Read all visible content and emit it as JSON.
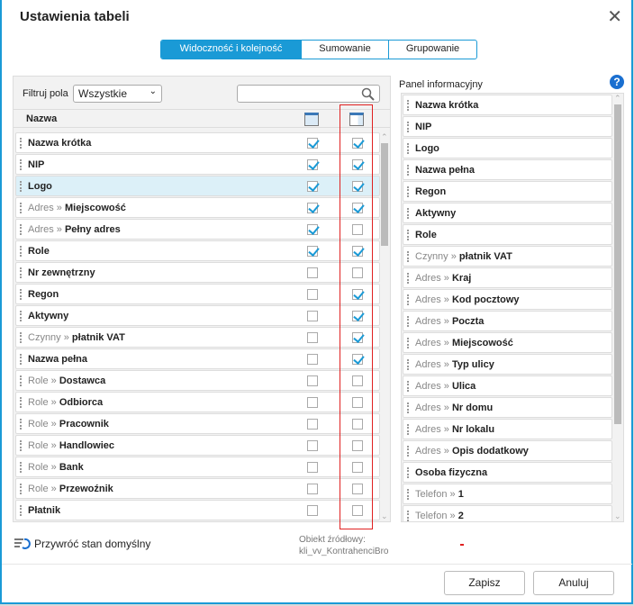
{
  "title": "Ustawienia tabeli",
  "tabs": [
    "Widoczność i kolejność",
    "Sumowanie",
    "Grupowanie"
  ],
  "filter": {
    "label": "Filtruj pola",
    "value": "Wszystkie",
    "search_value": ""
  },
  "left": {
    "header": "Nazwa",
    "rows": [
      {
        "prefix": "",
        "name": "Nazwa krótka",
        "c1": true,
        "c2": true
      },
      {
        "prefix": "",
        "name": "NIP",
        "c1": true,
        "c2": true
      },
      {
        "prefix": "",
        "name": "Logo",
        "c1": true,
        "c2": true,
        "selected": true
      },
      {
        "prefix": "Adres » ",
        "name": "Miejscowość",
        "c1": true,
        "c2": true
      },
      {
        "prefix": "Adres » ",
        "name": "Pełny adres",
        "c1": true,
        "c2": false
      },
      {
        "prefix": "",
        "name": "Role",
        "c1": true,
        "c2": true
      },
      {
        "prefix": "",
        "name": "Nr zewnętrzny",
        "c1": false,
        "c2": false
      },
      {
        "prefix": "",
        "name": "Regon",
        "c1": false,
        "c2": true
      },
      {
        "prefix": "",
        "name": "Aktywny",
        "c1": false,
        "c2": true
      },
      {
        "prefix": "Czynny » ",
        "name": "płatnik VAT",
        "c1": false,
        "c2": true
      },
      {
        "prefix": "",
        "name": "Nazwa pełna",
        "c1": false,
        "c2": true
      },
      {
        "prefix": "Role » ",
        "name": "Dostawca",
        "c1": false,
        "c2": false
      },
      {
        "prefix": "Role » ",
        "name": "Odbiorca",
        "c1": false,
        "c2": false
      },
      {
        "prefix": "Role » ",
        "name": "Pracownik",
        "c1": false,
        "c2": false
      },
      {
        "prefix": "Role » ",
        "name": "Handlowiec",
        "c1": false,
        "c2": false
      },
      {
        "prefix": "Role » ",
        "name": "Bank",
        "c1": false,
        "c2": false
      },
      {
        "prefix": "Role » ",
        "name": "Przewoźnik",
        "c1": false,
        "c2": false
      },
      {
        "prefix": "",
        "name": "Płatnik",
        "c1": false,
        "c2": false
      }
    ]
  },
  "right": {
    "title": "Panel informacyjny",
    "help": "?",
    "rows": [
      {
        "prefix": "",
        "name": "Nazwa krótka"
      },
      {
        "prefix": "",
        "name": "NIP"
      },
      {
        "prefix": "",
        "name": "Logo"
      },
      {
        "prefix": "",
        "name": "Nazwa pełna"
      },
      {
        "prefix": "",
        "name": "Regon"
      },
      {
        "prefix": "",
        "name": "Aktywny"
      },
      {
        "prefix": "",
        "name": "Role"
      },
      {
        "prefix": "Czynny » ",
        "name": "płatnik VAT"
      },
      {
        "prefix": "Adres » ",
        "name": "Kraj"
      },
      {
        "prefix": "Adres » ",
        "name": "Kod pocztowy"
      },
      {
        "prefix": "Adres » ",
        "name": "Poczta"
      },
      {
        "prefix": "Adres » ",
        "name": "Miejscowość"
      },
      {
        "prefix": "Adres » ",
        "name": "Typ ulicy"
      },
      {
        "prefix": "Adres » ",
        "name": "Ulica"
      },
      {
        "prefix": "Adres » ",
        "name": "Nr domu"
      },
      {
        "prefix": "Adres » ",
        "name": "Nr lokalu"
      },
      {
        "prefix": "Adres » ",
        "name": "Opis dodatkowy"
      },
      {
        "prefix": "",
        "name": "Osoba fizyczna"
      },
      {
        "prefix": "Telefon » ",
        "name": "1"
      },
      {
        "prefix": "Telefon » ",
        "name": "2"
      }
    ]
  },
  "footer": {
    "reset": "Przywróć stan domyślny",
    "source_label": "Obiekt źródłowy:",
    "source_value": "kli_vv_KontrahenciBro",
    "save": "Zapisz",
    "cancel": "Anuluj"
  }
}
